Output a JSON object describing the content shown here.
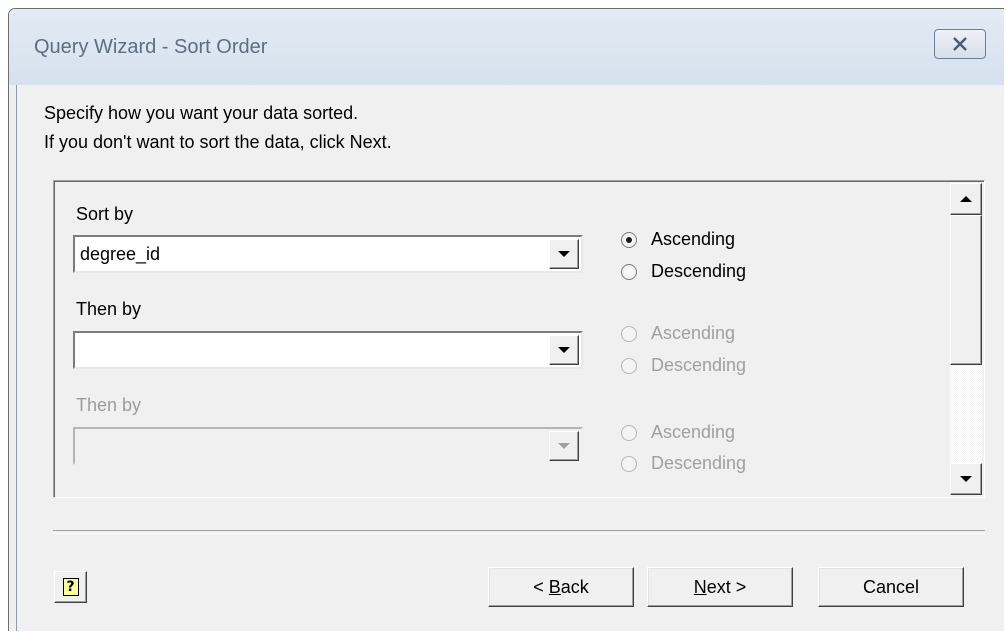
{
  "window": {
    "title": "Query Wizard - Sort Order",
    "close_symbol": "×"
  },
  "instructions": {
    "line1": "Specify how you want your data sorted.",
    "line2": "If you don't want to sort the data, click Next."
  },
  "sort_fields": [
    {
      "label": "Sort by",
      "value": "degree_id",
      "enabled": true,
      "ascending_label": "Ascending",
      "descending_label": "Descending",
      "selected": "ascending"
    },
    {
      "label": "Then by",
      "value": "",
      "enabled": true,
      "ascending_label": "Ascending",
      "descending_label": "Descending",
      "selected": "none"
    },
    {
      "label": "Then by",
      "value": "",
      "enabled": false,
      "ascending_label": "Ascending",
      "descending_label": "Descending",
      "selected": "none"
    }
  ],
  "buttons": {
    "help_glyph": "?",
    "back_prefix": "< ",
    "back_accel": "B",
    "back_rest": "ack",
    "next_accel": "N",
    "next_rest": "ext >",
    "cancel": "Cancel"
  },
  "icons": {
    "close": "close-icon",
    "help": "help-icon",
    "dropdown": "chevron-down-icon",
    "scroll_up": "arrow-up-icon",
    "scroll_down": "arrow-down-icon"
  }
}
